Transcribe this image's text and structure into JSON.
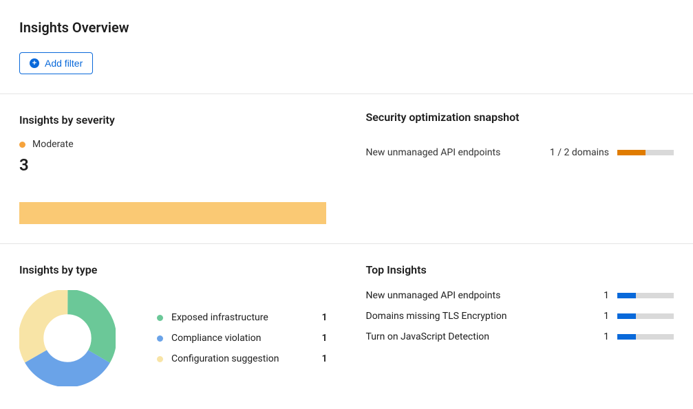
{
  "header": {
    "title": "Insights Overview",
    "add_filter": "Add filter"
  },
  "severity": {
    "title": "Insights by severity",
    "legend_label": "Moderate",
    "legend_color": "#f6a33c",
    "count": "3",
    "bar_color": "#fac974"
  },
  "snapshot": {
    "title": "Security optimization snapshot",
    "row_label": "New unmanaged API endpoints",
    "row_value": "1 / 2 domains",
    "bar_color": "#e07c00",
    "bar_pct": 50
  },
  "by_type": {
    "title": "Insights by type",
    "items": [
      {
        "label": "Exposed infrastructure",
        "value": "1",
        "color": "#6bc898"
      },
      {
        "label": "Compliance violation",
        "value": "1",
        "color": "#6aa3e8"
      },
      {
        "label": "Configuration suggestion",
        "value": "1",
        "color": "#f8e4a6"
      }
    ]
  },
  "top": {
    "title": "Top Insights",
    "items": [
      {
        "label": "New unmanaged API endpoints",
        "count": "1",
        "bar_color": "#0969da",
        "bar_pct": 33
      },
      {
        "label": "Domains missing TLS Encryption",
        "count": "1",
        "bar_color": "#0969da",
        "bar_pct": 33
      },
      {
        "label": "Turn on JavaScript Detection",
        "count": "1",
        "bar_color": "#0969da",
        "bar_pct": 33
      }
    ]
  },
  "chart_data": {
    "type": "pie",
    "title": "Insights by type",
    "categories": [
      "Exposed infrastructure",
      "Compliance violation",
      "Configuration suggestion"
    ],
    "values": [
      1,
      1,
      1
    ],
    "colors": [
      "#6bc898",
      "#6aa3e8",
      "#f8e4a6"
    ]
  }
}
